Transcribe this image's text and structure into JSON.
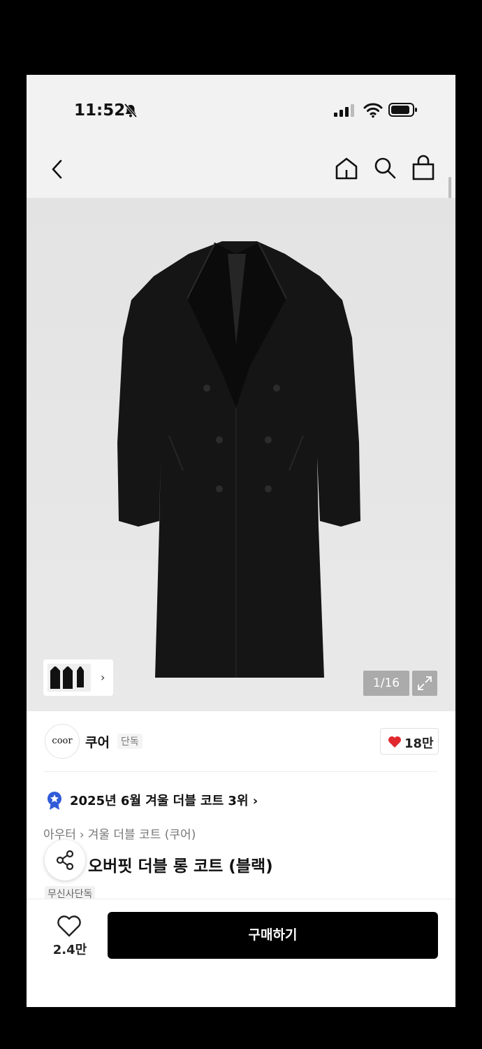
{
  "status_bar": {
    "time": "11:52"
  },
  "product_image": {
    "counter": "1/16"
  },
  "brand": {
    "logo_text": "coor",
    "name": "쿠어",
    "tag": "단독",
    "likes": "18만"
  },
  "ranking": {
    "text": "2025년 6월 겨울 더블 코트 3위 ›"
  },
  "breadcrumb": [
    "아우터",
    "겨울 더블 코트 (쿠어)"
  ],
  "product": {
    "title": "오버핏 더블 롱 코트 (블랙)",
    "exclusive_badge": "무신사단독"
  },
  "bottom_bar": {
    "wish_count": "2.4만",
    "buy_label": "구매하기"
  },
  "colors": {
    "accent": "#000000",
    "heart": "#e0282e",
    "rank_badge": "#2f5bd8"
  }
}
